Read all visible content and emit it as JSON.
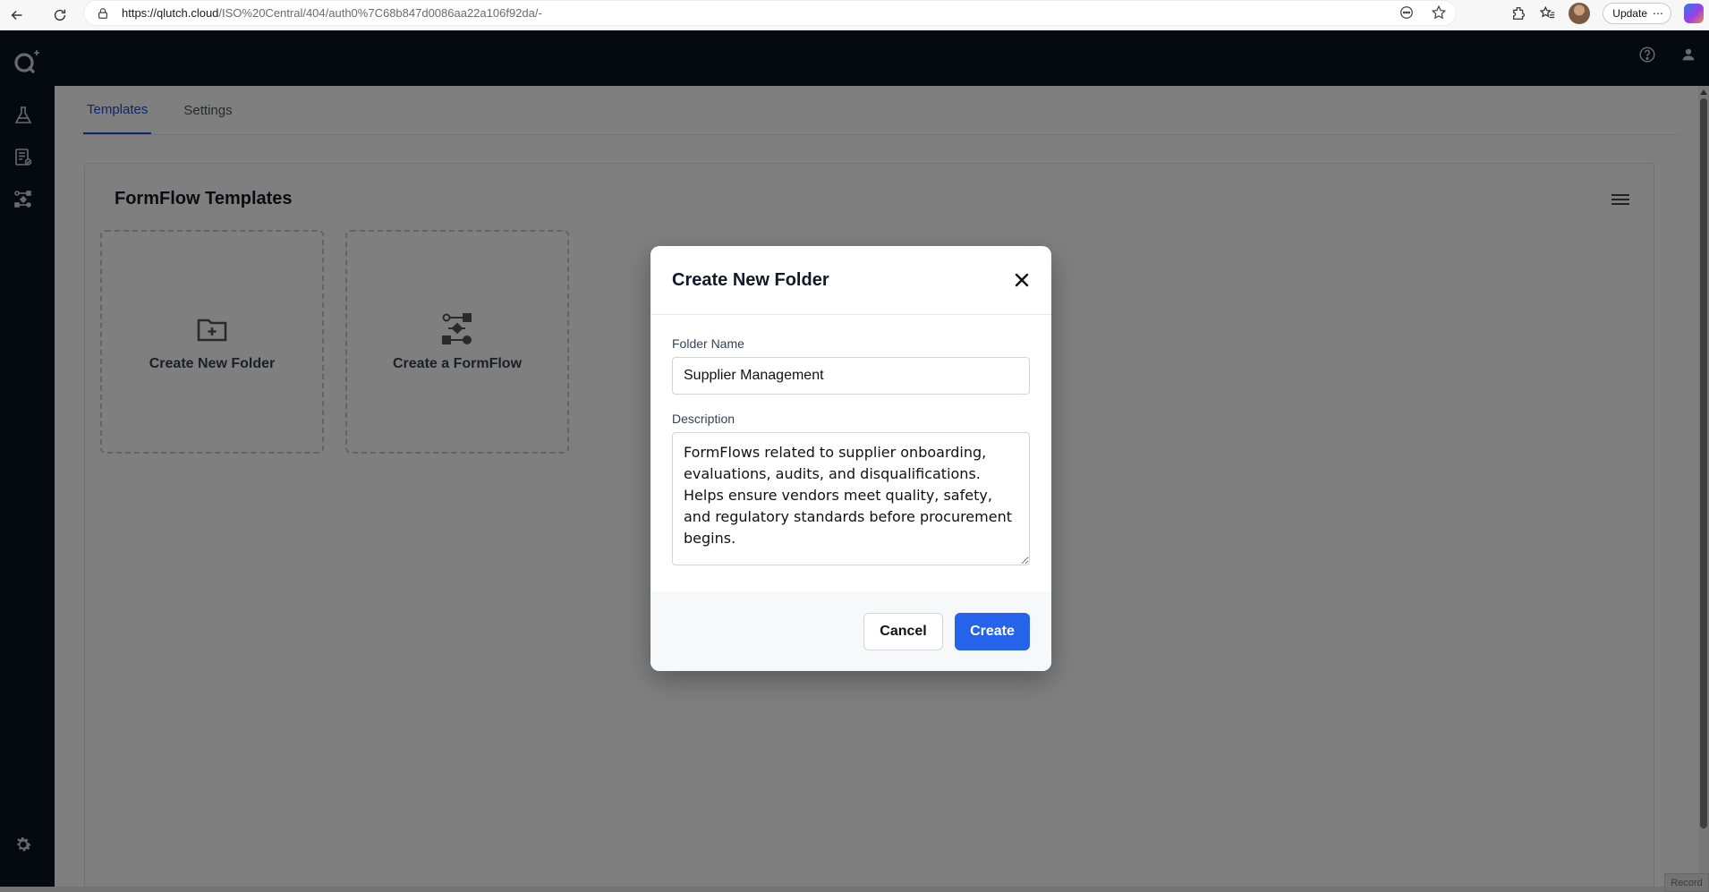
{
  "browser": {
    "url_host": "https://qlutch.cloud",
    "url_path": "/ISO%20Central/404/auth0%7C68b847d0086aa22a106f92da/-",
    "update_label": "Update"
  },
  "tabs": [
    {
      "label": "Templates",
      "active": true
    },
    {
      "label": "Settings",
      "active": false
    }
  ],
  "panel": {
    "title": "FormFlow Templates",
    "tiles": [
      {
        "label": "Create New Folder",
        "icon": "folder-plus-icon"
      },
      {
        "label": "Create a FormFlow",
        "icon": "flow-icon"
      }
    ]
  },
  "modal": {
    "title": "Create New Folder",
    "folder_name_label": "Folder Name",
    "folder_name_value": "Supplier Management",
    "description_label": "Description",
    "description_value": "FormFlows related to supplier onboarding, evaluations, audits, and disqualifications. Helps ensure vendors meet quality, safety, and regulatory standards before procurement begins.",
    "cancel_label": "Cancel",
    "create_label": "Create"
  },
  "footer": {
    "record_label": "Record"
  },
  "colors": {
    "app_dark": "#0b1420",
    "accent": "#2563eb",
    "tab_active": "#1d4ed8"
  }
}
